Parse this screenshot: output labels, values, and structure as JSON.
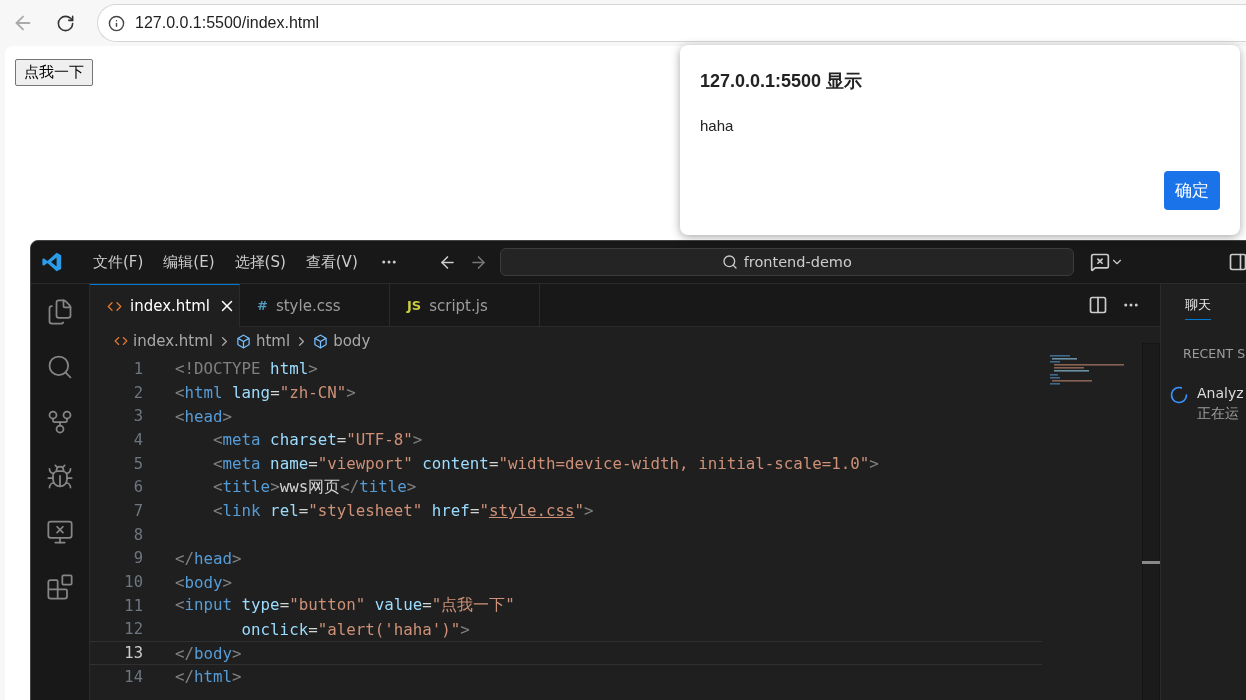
{
  "browser": {
    "address": "127.0.0.1:5500/index.html",
    "page_button": "点我一下"
  },
  "alert": {
    "title": "127.0.0.1:5500 显示",
    "message": "haha",
    "button": "确定"
  },
  "editor": {
    "menu": [
      "文件(F)",
      "编辑(E)",
      "选择(S)",
      "查看(V)"
    ],
    "search": "frontend-demo",
    "tabs": [
      {
        "label": "index.html",
        "kind": "html",
        "selected": true
      },
      {
        "label": "style.css",
        "kind": "css",
        "icon": "#",
        "selected": false
      },
      {
        "label": "script.js",
        "kind": "js",
        "icon": "JS",
        "selected": false
      }
    ],
    "breadcrumb": [
      {
        "label": "index.html",
        "kind": "file"
      },
      {
        "label": "html",
        "kind": "element"
      },
      {
        "label": "body",
        "kind": "element"
      }
    ],
    "lines": [
      {
        "number": "1",
        "current": false,
        "tokens": [
          {
            "t": "<!DOCTYPE",
            "kind": "punct"
          },
          {
            "t": " html",
            "kind": "attr"
          },
          {
            "t": ">",
            "kind": "punct"
          }
        ]
      },
      {
        "number": "2",
        "current": false,
        "tokens": [
          {
            "t": "<",
            "kind": "punct"
          },
          {
            "t": "html",
            "kind": "tag"
          },
          {
            "t": " lang",
            "kind": "attr"
          },
          {
            "t": "=",
            "kind": "text"
          },
          {
            "t": "\"zh-CN\"",
            "kind": "str"
          },
          {
            "t": ">",
            "kind": "punct"
          }
        ]
      },
      {
        "number": "3",
        "current": false,
        "tokens": [
          {
            "t": "<",
            "kind": "punct"
          },
          {
            "t": "head",
            "kind": "tag"
          },
          {
            "t": ">",
            "kind": "punct"
          }
        ]
      },
      {
        "number": "4",
        "current": false,
        "tokens": [
          {
            "t": "    <",
            "kind": "punct"
          },
          {
            "t": "meta",
            "kind": "tag"
          },
          {
            "t": " charset",
            "kind": "attr"
          },
          {
            "t": "=",
            "kind": "text"
          },
          {
            "t": "\"UTF-8\"",
            "kind": "str"
          },
          {
            "t": ">",
            "kind": "punct"
          }
        ]
      },
      {
        "number": "5",
        "current": false,
        "tokens": [
          {
            "t": "    <",
            "kind": "punct"
          },
          {
            "t": "meta",
            "kind": "tag"
          },
          {
            "t": " name",
            "kind": "attr"
          },
          {
            "t": "=",
            "kind": "text"
          },
          {
            "t": "\"viewport\"",
            "kind": "str"
          },
          {
            "t": " content",
            "kind": "attr"
          },
          {
            "t": "=",
            "kind": "text"
          },
          {
            "t": "\"width=device-width, initial-scale=1.0\"",
            "kind": "str"
          },
          {
            "t": ">",
            "kind": "punct"
          }
        ]
      },
      {
        "number": "6",
        "current": false,
        "tokens": [
          {
            "t": "    <",
            "kind": "punct"
          },
          {
            "t": "title",
            "kind": "tag"
          },
          {
            "t": ">",
            "kind": "punct"
          },
          {
            "t": "wws网页",
            "kind": "text"
          },
          {
            "t": "</",
            "kind": "punct"
          },
          {
            "t": "title",
            "kind": "tag"
          },
          {
            "t": ">",
            "kind": "punct"
          }
        ]
      },
      {
        "number": "7",
        "current": false,
        "tokens": [
          {
            "t": "    <",
            "kind": "punct"
          },
          {
            "t": "link",
            "kind": "tag"
          },
          {
            "t": " rel",
            "kind": "attr"
          },
          {
            "t": "=",
            "kind": "text"
          },
          {
            "t": "\"stylesheet\"",
            "kind": "str"
          },
          {
            "t": " href",
            "kind": "attr"
          },
          {
            "t": "=",
            "kind": "text"
          },
          {
            "t": "\"",
            "kind": "str"
          },
          {
            "t": "style.css",
            "kind": "link"
          },
          {
            "t": "\"",
            "kind": "str"
          },
          {
            "t": ">",
            "kind": "punct"
          }
        ]
      },
      {
        "number": "8",
        "current": false
      },
      {
        "number": "9",
        "current": false,
        "tokens": [
          {
            "t": "</",
            "kind": "punct"
          },
          {
            "t": "head",
            "kind": "tag"
          },
          {
            "t": ">",
            "kind": "punct"
          }
        ]
      },
      {
        "number": "10",
        "current": false,
        "tokens": [
          {
            "t": "<",
            "kind": "punct"
          },
          {
            "t": "body",
            "kind": "tag"
          },
          {
            "t": ">",
            "kind": "punct"
          }
        ]
      },
      {
        "number": "11",
        "current": false,
        "tokens": [
          {
            "t": "<",
            "kind": "punct"
          },
          {
            "t": "input",
            "kind": "tag"
          },
          {
            "t": " type",
            "kind": "attr"
          },
          {
            "t": "=",
            "kind": "text"
          },
          {
            "t": "\"button\"",
            "kind": "str"
          },
          {
            "t": " value",
            "kind": "attr"
          },
          {
            "t": "=",
            "kind": "text"
          },
          {
            "t": "\"点我一下\"",
            "kind": "str"
          }
        ]
      },
      {
        "number": "12",
        "current": false,
        "tokens": [
          {
            "t": "       onclick",
            "kind": "attr"
          },
          {
            "t": "=",
            "kind": "text"
          },
          {
            "t": "\"alert('haha')\"",
            "kind": "str"
          },
          {
            "t": ">",
            "kind": "punct"
          }
        ]
      },
      {
        "number": "13",
        "current": true,
        "tokens": [
          {
            "t": "</",
            "kind": "punct"
          },
          {
            "t": "body",
            "kind": "tag"
          },
          {
            "t": ">",
            "kind": "punct"
          }
        ]
      },
      {
        "number": "14",
        "current": false,
        "tokens": [
          {
            "t": "</",
            "kind": "punct"
          },
          {
            "t": "html",
            "kind": "tag"
          },
          {
            "t": ">",
            "kind": "punct"
          }
        ]
      }
    ]
  },
  "side_panel": {
    "tab": {
      "label": "聊天",
      "selected": true
    },
    "section": "RECENT S",
    "session": {
      "title": "Analyz",
      "status": "正在运"
    }
  }
}
